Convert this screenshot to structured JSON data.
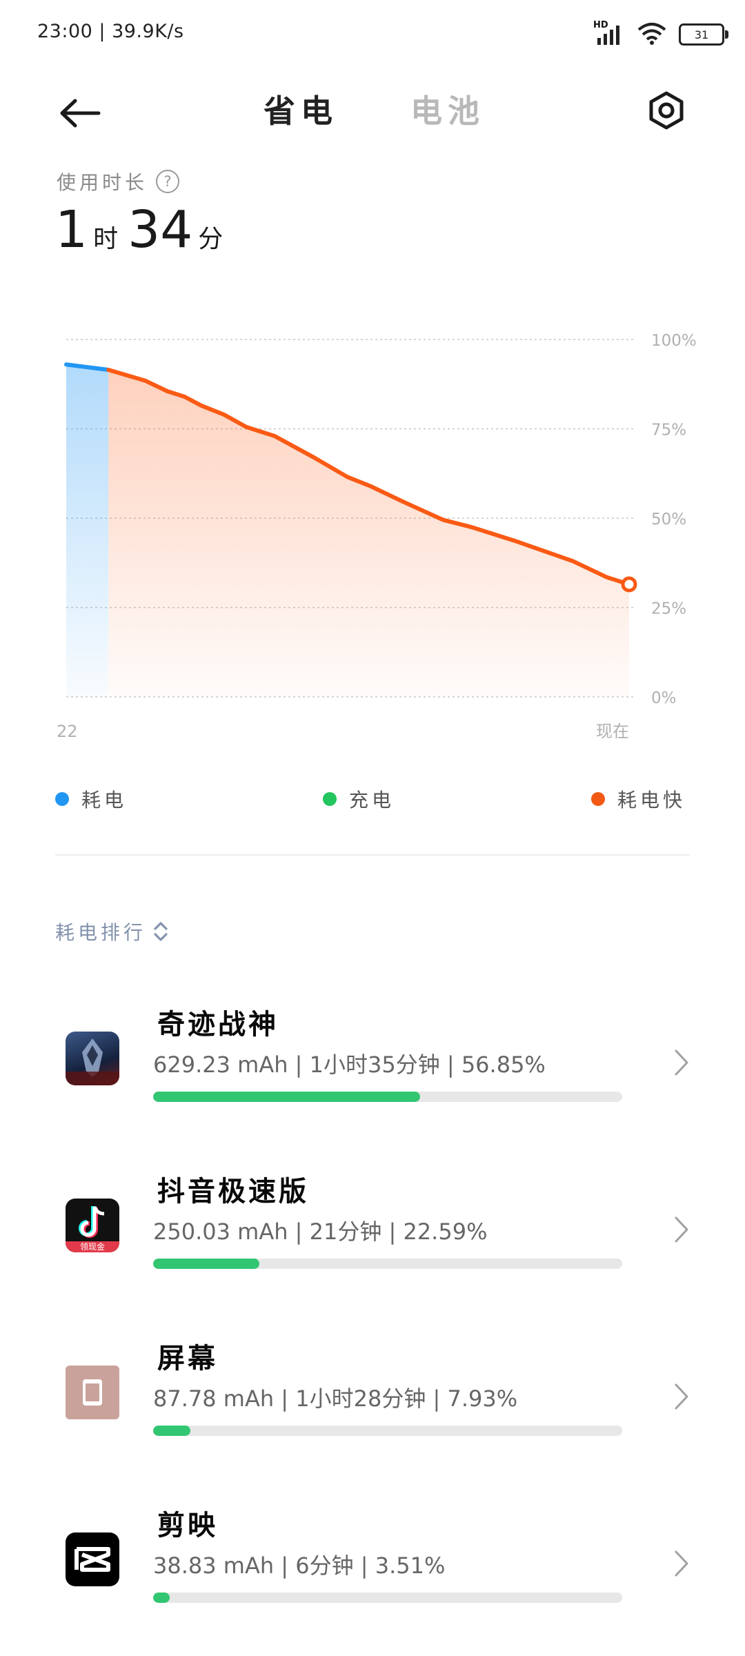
{
  "status_bar": {
    "time_speed": "23:00 | 39.9K/s",
    "network": "HD",
    "battery_level": "31"
  },
  "header": {
    "tab_saving": "省电",
    "tab_battery": "电池"
  },
  "usage": {
    "label": "使用时长",
    "hours": "1",
    "hours_unit": "时",
    "minutes": "34",
    "minutes_unit": "分"
  },
  "chart_data": {
    "type": "line",
    "title": "",
    "xlabel": "",
    "ylabel": "",
    "y_ticks": [
      "100%",
      "75%",
      "50%",
      "25%",
      "0%"
    ],
    "x_labels": [
      "22",
      "现在"
    ],
    "ylim": [
      0,
      100
    ],
    "grid": true,
    "series": [
      {
        "name": "耗电",
        "color": "#2196f3",
        "points": [
          [
            0,
            93
          ],
          [
            0.075,
            91.5
          ]
        ]
      },
      {
        "name": "耗电快",
        "color": "#fa5a14",
        "points": [
          [
            0.075,
            91.5
          ],
          [
            0.14,
            88.5
          ],
          [
            0.18,
            85.5
          ],
          [
            0.21,
            84
          ],
          [
            0.24,
            81.5
          ],
          [
            0.28,
            79
          ],
          [
            0.32,
            75.5
          ],
          [
            0.37,
            73
          ],
          [
            0.44,
            67
          ],
          [
            0.5,
            61.5
          ],
          [
            0.54,
            59
          ],
          [
            0.6,
            54.5
          ],
          [
            0.67,
            49.5
          ],
          [
            0.72,
            47.5
          ],
          [
            0.8,
            43.5
          ],
          [
            0.9,
            38
          ],
          [
            0.96,
            33.5
          ],
          [
            1.0,
            31.5
          ]
        ]
      }
    ]
  },
  "legend": [
    {
      "label": "耗电",
      "color": "#2196f3"
    },
    {
      "label": "充电",
      "color": "#22c55e"
    },
    {
      "label": "耗电快",
      "color": "#f25a14"
    }
  ],
  "ranking": {
    "title": "耗电排行",
    "apps": [
      {
        "name": "奇迹战神",
        "stats": "629.23 mAh | 1小时35分钟 | 56.85%",
        "progress": 0.5685,
        "icon": "game-icon"
      },
      {
        "name": "抖音极速版",
        "stats": "250.03 mAh | 21分钟 | 22.59%",
        "progress": 0.2259,
        "icon": "douyin-icon",
        "icon_caption": "领现金"
      },
      {
        "name": "屏幕",
        "stats": "87.78 mAh | 1小时28分钟 | 7.93%",
        "progress": 0.0793,
        "icon": "screen-icon"
      },
      {
        "name": "剪映",
        "stats": "38.83 mAh | 6分钟 | 3.51%",
        "progress": 0.0351,
        "icon": "capcut-icon"
      }
    ]
  }
}
